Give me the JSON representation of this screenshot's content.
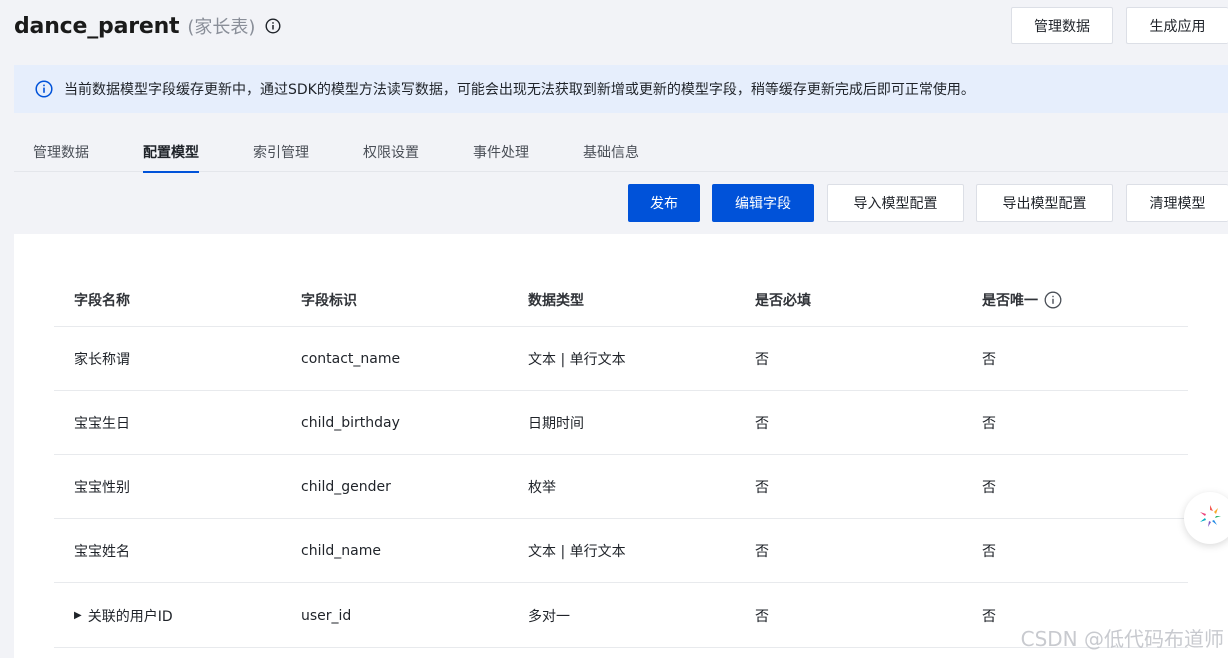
{
  "header": {
    "title": "dance_parent",
    "subtitle": "(家长表)",
    "manage_data_label": "管理数据",
    "generate_app_label": "生成应用"
  },
  "notice": {
    "text": "当前数据模型字段缓存更新中，通过SDK的模型方法读写数据，可能会出现无法获取到新增或更新的模型字段，稍等缓存更新完成后即可正常使用。"
  },
  "tabs": [
    {
      "label": "管理数据"
    },
    {
      "label": "配置模型",
      "active": true
    },
    {
      "label": "索引管理"
    },
    {
      "label": "权限设置"
    },
    {
      "label": "事件处理"
    },
    {
      "label": "基础信息"
    }
  ],
  "toolbar": {
    "publish": "发布",
    "edit_fields": "编辑字段",
    "import_config": "导入模型配置",
    "export_config": "导出模型配置",
    "clear_model": "清理模型"
  },
  "table": {
    "columns": [
      "字段名称",
      "字段标识",
      "数据类型",
      "是否必填",
      "是否唯一"
    ],
    "rows": [
      {
        "name": "家长称谓",
        "key": "contact_name",
        "type": "文本 | 单行文本",
        "required": "否",
        "unique": "否"
      },
      {
        "name": "宝宝生日",
        "key": "child_birthday",
        "type": "日期时间",
        "required": "否",
        "unique": "否"
      },
      {
        "name": "宝宝性别",
        "key": "child_gender",
        "type": "枚举",
        "required": "否",
        "unique": "否"
      },
      {
        "name": "宝宝姓名",
        "key": "child_name",
        "type": "文本 | 单行文本",
        "required": "否",
        "unique": "否"
      },
      {
        "name": "关联的用户ID",
        "key": "user_id",
        "type": "多对一",
        "required": "否",
        "unique": "否",
        "expandable": true
      }
    ]
  },
  "watermark": "CSDN @低代码布道师",
  "colors": {
    "primary": "#0052d9",
    "notice_bg": "#e6eefc",
    "page_bg": "#f2f3f7"
  },
  "icons": {
    "title_info": "info-circle-icon",
    "notice": "info-circle-icon",
    "unique_help": "info-circle-icon",
    "assistant": "assistant-logo-icon",
    "expand": "caret-right-icon"
  }
}
